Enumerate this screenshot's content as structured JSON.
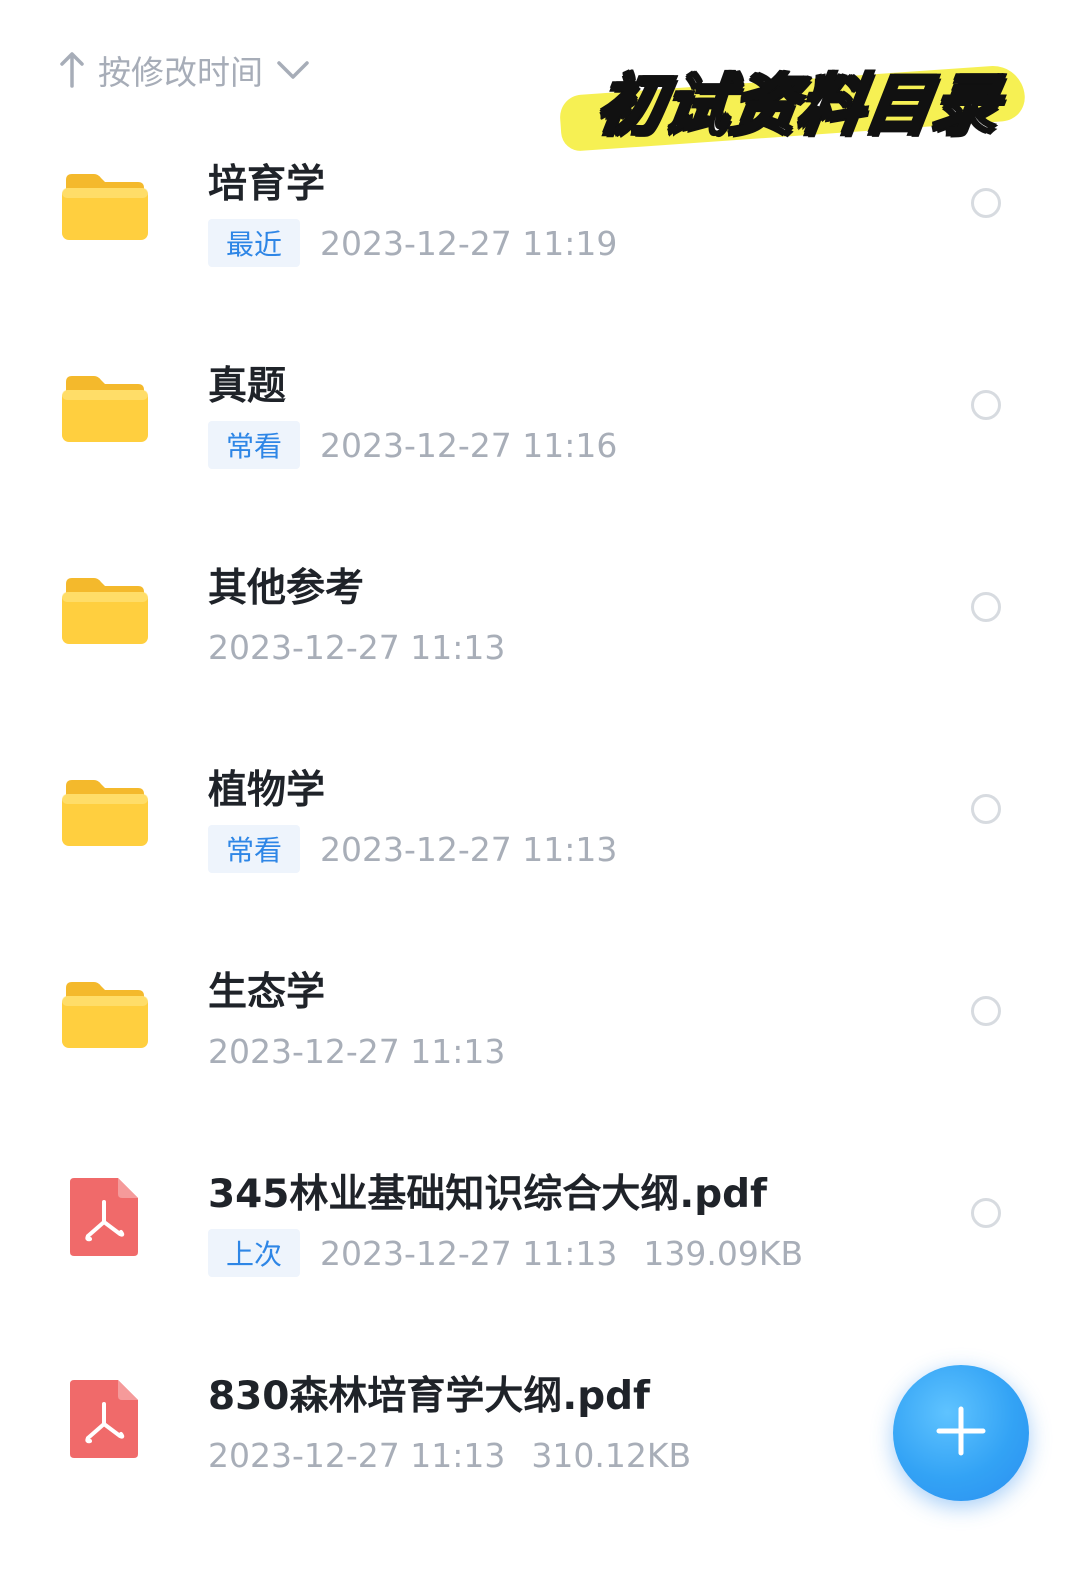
{
  "sort": {
    "label": "按修改时间"
  },
  "overlay": {
    "title": "初试资料目录"
  },
  "items": [
    {
      "type": "folder",
      "name": "培育学",
      "tag": "最近",
      "date": "2023-12-27  11:19",
      "size": ""
    },
    {
      "type": "folder",
      "name": "真题",
      "tag": "常看",
      "date": "2023-12-27  11:16",
      "size": ""
    },
    {
      "type": "folder",
      "name": "其他参考",
      "tag": "",
      "date": "2023-12-27  11:13",
      "size": ""
    },
    {
      "type": "folder",
      "name": "植物学",
      "tag": "常看",
      "date": "2023-12-27  11:13",
      "size": ""
    },
    {
      "type": "folder",
      "name": "生态学",
      "tag": "",
      "date": "2023-12-27  11:13",
      "size": ""
    },
    {
      "type": "pdf",
      "name": "345林业基础知识综合大纲.pdf",
      "tag": "上次",
      "date": "2023-12-27  11:13",
      "size": "139.09KB"
    },
    {
      "type": "pdf",
      "name": "830森林培育学大纲.pdf",
      "tag": "",
      "date": "2023-12-27  11:13",
      "size": "310.12KB"
    }
  ],
  "icons": {
    "sort_direction": "arrow-up-icon",
    "sort_dropdown": "chevron-down-icon",
    "folder": "folder-icon",
    "pdf": "pdf-file-icon",
    "select": "radio-icon",
    "fab": "plus-icon"
  },
  "colors": {
    "accent": "#2e86e6",
    "folder": "#ffcf3f",
    "pdf": "#f06a6a",
    "fab": "#33a3f5",
    "highlight": "#f6ef4a"
  }
}
